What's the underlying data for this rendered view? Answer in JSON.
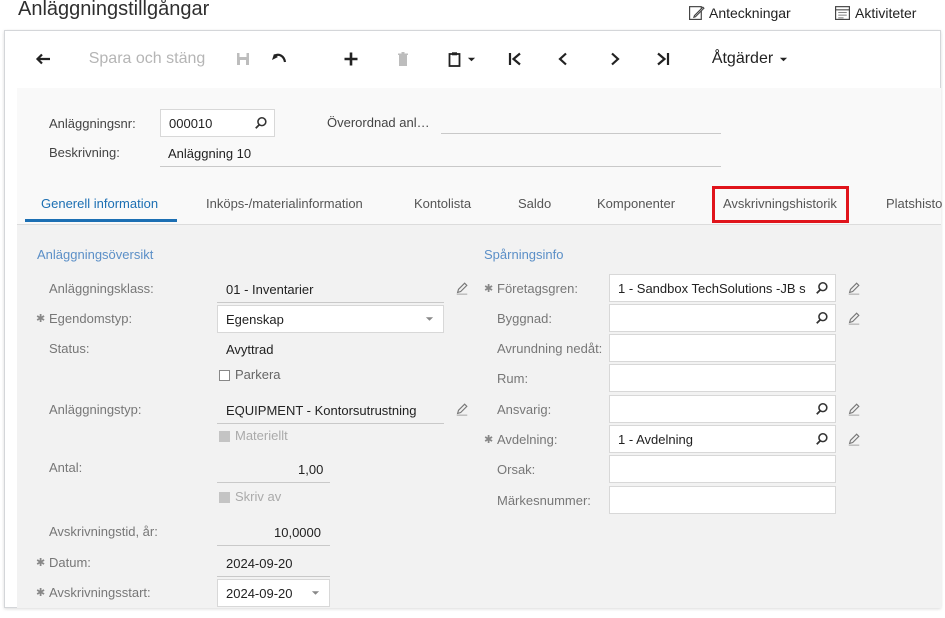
{
  "window": {
    "title": "Anläggningstillgångar",
    "notes_label": "Anteckningar",
    "activities_label": "Aktiviteter"
  },
  "toolbar": {
    "save_close_label": "Spara och stäng",
    "actions_label": "Åtgärder"
  },
  "header": {
    "asset_no_label": "Anläggningsnr:",
    "asset_no_value": "000010",
    "parent_label": "Överordnad anl…",
    "description_label": "Beskrivning:",
    "description_value": "Anläggning 10"
  },
  "tabs": [
    {
      "label": "Generell information"
    },
    {
      "label": "Inköps-/materialinformation"
    },
    {
      "label": "Kontolista"
    },
    {
      "label": "Saldo"
    },
    {
      "label": "Komponenter"
    },
    {
      "label": "Avskrivningshistorik"
    },
    {
      "label": "Platshisto"
    }
  ],
  "overview": {
    "heading": "Anläggningsöversikt",
    "class_label": "Anläggningsklass:",
    "class_value": "01 - Inventarier",
    "property_type_label": "Egendomstyp:",
    "property_type_value": "Egenskap",
    "status_label": "Status:",
    "status_value": "Avyttrad",
    "park_label": "Parkera",
    "asset_type_label": "Anläggningstyp:",
    "asset_type_value": "EQUIPMENT - Kontorsutrustning",
    "tangible_label": "Materiellt",
    "quantity_label": "Antal:",
    "quantity_value": "1,00",
    "depreciate_label": "Skriv av",
    "useful_life_label": "Avskrivningstid, år:",
    "useful_life_value": "10,0000",
    "date_label": "Datum:",
    "date_value": "2024-09-20",
    "dep_start_label": "Avskrivningsstart:",
    "dep_start_value": "2024-09-20"
  },
  "tracking": {
    "heading": "Spårningsinfo",
    "branch_label": "Företagsgren:",
    "branch_value": "1 - Sandbox TechSolutions -JB s",
    "building_label": "Byggnad:",
    "floor_label": "Avrundning nedåt:",
    "room_label": "Rum:",
    "custodian_label": "Ansvarig:",
    "department_label": "Avdelning:",
    "department_value": "1 - Avdelning",
    "reason_label": "Orsak:",
    "tag_label": "Märkesnummer:"
  },
  "colors": {
    "accent": "#1c6fb3",
    "highlight": "#e0141b",
    "section_heading": "#5b8fc7"
  }
}
